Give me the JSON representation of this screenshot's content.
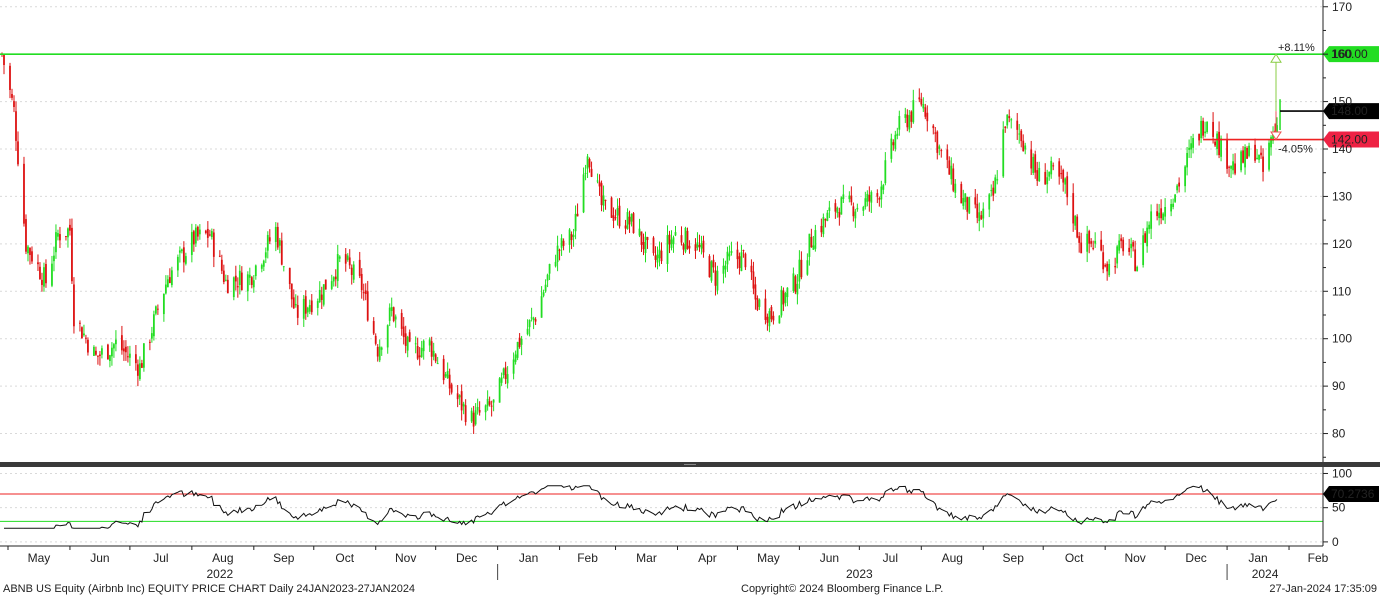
{
  "footer": {
    "left": "ABNB US Equity (Airbnb Inc) EQUITY PRICE CHART  Daily 24JAN2023-27JAN2024",
    "center": "Copyright© 2024 Bloomberg Finance L.P.",
    "right": "27-Jan-2024 17:35:09"
  },
  "colors": {
    "up": "#22dd22",
    "down": "#dd1111",
    "green_line": "#22dd22",
    "red_line": "#ee2222",
    "black_line": "#000000",
    "arrow": "#88cc44",
    "label_green_bg": "#22dd22",
    "label_red_bg": "#ee2244"
  },
  "chart_data": {
    "type": "candlestick",
    "price_panel": {
      "ylim": [
        74,
        171
      ],
      "yticks": [
        80,
        90,
        100,
        110,
        120,
        130,
        140,
        150,
        160,
        170
      ],
      "grid": true,
      "series_path": [
        [
          "2022-04-28",
          160
        ],
        [
          "2022-05-04",
          148
        ],
        [
          "2022-05-10",
          120
        ],
        [
          "2022-05-20",
          112
        ],
        [
          "2022-05-26",
          122
        ],
        [
          "2022-06-01",
          123
        ],
        [
          "2022-06-03",
          105
        ],
        [
          "2022-06-14",
          96
        ],
        [
          "2022-06-24",
          99
        ],
        [
          "2022-07-06",
          94
        ],
        [
          "2022-07-20",
          113
        ],
        [
          "2022-08-02",
          121
        ],
        [
          "2022-08-10",
          122
        ],
        [
          "2022-08-18",
          112
        ],
        [
          "2022-08-30",
          113
        ],
        [
          "2022-09-12",
          123
        ],
        [
          "2022-09-22",
          105
        ],
        [
          "2022-10-05",
          110
        ],
        [
          "2022-10-15",
          117
        ],
        [
          "2022-10-25",
          111
        ],
        [
          "2022-11-02",
          98
        ],
        [
          "2022-11-09",
          106
        ],
        [
          "2022-11-18",
          97
        ],
        [
          "2022-11-28",
          99
        ],
        [
          "2022-12-09",
          89
        ],
        [
          "2022-12-19",
          83
        ],
        [
          "2022-12-30",
          86
        ],
        [
          "2023-01-10",
          98
        ],
        [
          "2023-01-20",
          105
        ],
        [
          "2023-01-30",
          118
        ],
        [
          "2023-02-08",
          122
        ],
        [
          "2023-02-15",
          140
        ],
        [
          "2023-02-22",
          128
        ],
        [
          "2023-03-02",
          126
        ],
        [
          "2023-03-10",
          124
        ],
        [
          "2023-03-20",
          116
        ],
        [
          "2023-03-31",
          122
        ],
        [
          "2023-04-10",
          120
        ],
        [
          "2023-04-20",
          113
        ],
        [
          "2023-04-28",
          117
        ],
        [
          "2023-05-05",
          117
        ],
        [
          "2023-05-10",
          108
        ],
        [
          "2023-05-18",
          105
        ],
        [
          "2023-05-30",
          112
        ],
        [
          "2023-06-08",
          122
        ],
        [
          "2023-06-20",
          128
        ],
        [
          "2023-06-30",
          128
        ],
        [
          "2023-07-10",
          130
        ],
        [
          "2023-07-20",
          144
        ],
        [
          "2023-08-01",
          150
        ],
        [
          "2023-08-05",
          147
        ],
        [
          "2023-08-10",
          140
        ],
        [
          "2023-08-20",
          130
        ],
        [
          "2023-08-30",
          125
        ],
        [
          "2023-09-06",
          130
        ],
        [
          "2023-09-12",
          146
        ],
        [
          "2023-09-20",
          143
        ],
        [
          "2023-09-28",
          134
        ],
        [
          "2023-10-05",
          135
        ],
        [
          "2023-10-12",
          132
        ],
        [
          "2023-10-20",
          120
        ],
        [
          "2023-10-27",
          120
        ],
        [
          "2023-11-03",
          115
        ],
        [
          "2023-11-10",
          120
        ],
        [
          "2023-11-17",
          116
        ],
        [
          "2023-11-24",
          126
        ],
        [
          "2023-12-01",
          128
        ],
        [
          "2023-12-08",
          133
        ],
        [
          "2023-12-15",
          141
        ],
        [
          "2023-12-22",
          147
        ],
        [
          "2023-12-29",
          140
        ],
        [
          "2024-01-05",
          136
        ],
        [
          "2024-01-10",
          138
        ],
        [
          "2024-01-15",
          140
        ],
        [
          "2024-01-19",
          135
        ],
        [
          "2024-01-23",
          142
        ],
        [
          "2024-01-26",
          145
        ]
      ],
      "last_close": 148,
      "levels": [
        {
          "value": 160,
          "label": "160.00",
          "style": "green"
        },
        {
          "value": 148,
          "label": "148.00",
          "style": "black"
        },
        {
          "value": 142,
          "label": "142.00",
          "style": "red"
        }
      ],
      "annotations": [
        {
          "text": "+8.11%",
          "position": "above-arrow-up"
        },
        {
          "text": "-4.05%",
          "position": "below-arrow-down"
        }
      ]
    },
    "rsi_panel": {
      "ylim": [
        -6,
        108
      ],
      "yticks": [
        0,
        50,
        100
      ],
      "overbought": 70,
      "oversold": 30,
      "last_value_label": "70.2736"
    },
    "x_months": [
      {
        "label": "May",
        "date": "2022-05-01"
      },
      {
        "label": "Jun",
        "date": "2022-06-01"
      },
      {
        "label": "Jul",
        "date": "2022-07-01"
      },
      {
        "label": "Aug",
        "date": "2022-08-01"
      },
      {
        "label": "Sep",
        "date": "2022-09-01"
      },
      {
        "label": "Oct",
        "date": "2022-10-01"
      },
      {
        "label": "Nov",
        "date": "2022-11-01"
      },
      {
        "label": "Dec",
        "date": "2022-12-01"
      },
      {
        "label": "Jan",
        "date": "2023-01-01"
      },
      {
        "label": "Feb",
        "date": "2023-02-01"
      },
      {
        "label": "Mar",
        "date": "2023-03-01"
      },
      {
        "label": "Apr",
        "date": "2023-04-01"
      },
      {
        "label": "May",
        "date": "2023-05-01"
      },
      {
        "label": "Jun",
        "date": "2023-06-01"
      },
      {
        "label": "Jul",
        "date": "2023-07-01"
      },
      {
        "label": "Aug",
        "date": "2023-08-01"
      },
      {
        "label": "Sep",
        "date": "2023-09-01"
      },
      {
        "label": "Oct",
        "date": "2023-10-01"
      },
      {
        "label": "Nov",
        "date": "2023-11-01"
      },
      {
        "label": "Dec",
        "date": "2023-12-01"
      },
      {
        "label": "Jan",
        "date": "2024-01-01"
      },
      {
        "label": "Feb",
        "date": "2024-02-01"
      }
    ],
    "x_years": [
      {
        "label": "2022",
        "date": "2022-08-15"
      },
      {
        "label": "2023",
        "date": "2023-07-01"
      },
      {
        "label": "2024",
        "date": "2024-01-20"
      }
    ]
  }
}
